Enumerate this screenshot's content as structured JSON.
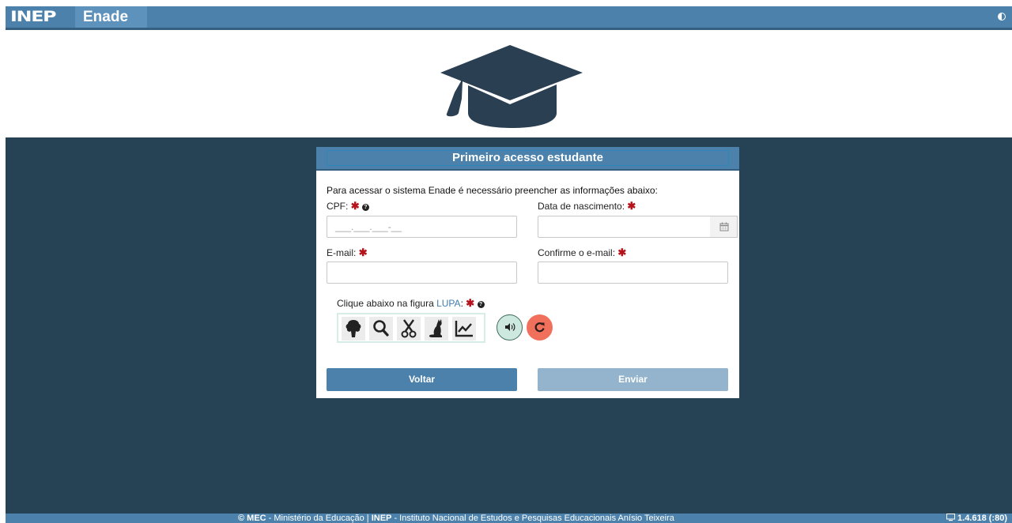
{
  "header": {
    "logo_text": "INEP",
    "app_name": "Enade"
  },
  "card": {
    "title": "Primeiro acesso estudante",
    "intro": "Para acessar o sistema Enade é necessário preencher as informações abaixo:",
    "fields": {
      "cpf_label": "CPF:",
      "cpf_value": "___.___.___-__",
      "birth_label": "Data de nascimento:",
      "email_label": "E-mail:",
      "confirm_label": "Confirme o e-mail:"
    },
    "required_marker": "✱",
    "captcha": {
      "prompt_prefix": "Clique abaixo na figura",
      "target": "LUPA",
      "prompt_suffix": ":",
      "options": [
        "tree-icon",
        "magnifier-icon",
        "scissors-icon",
        "cat-icon",
        "chart-icon"
      ]
    },
    "buttons": {
      "back": "Voltar",
      "send": "Enviar"
    }
  },
  "footer": {
    "copyright": "© MEC",
    "ministry": " - Ministério da Educação | ",
    "inep": "INEP",
    "institute": " - Instituto Nacional de Estudos e Pesquisas Educacionais Anísio Teixeira",
    "version": "1.4.618 (:80)"
  },
  "colors": {
    "primary": "#4b81aa",
    "band": "#264255",
    "required": "#b4141c",
    "refresh": "#f0705c",
    "audio": "#cde8df",
    "send_disabled": "#93b4cc"
  }
}
